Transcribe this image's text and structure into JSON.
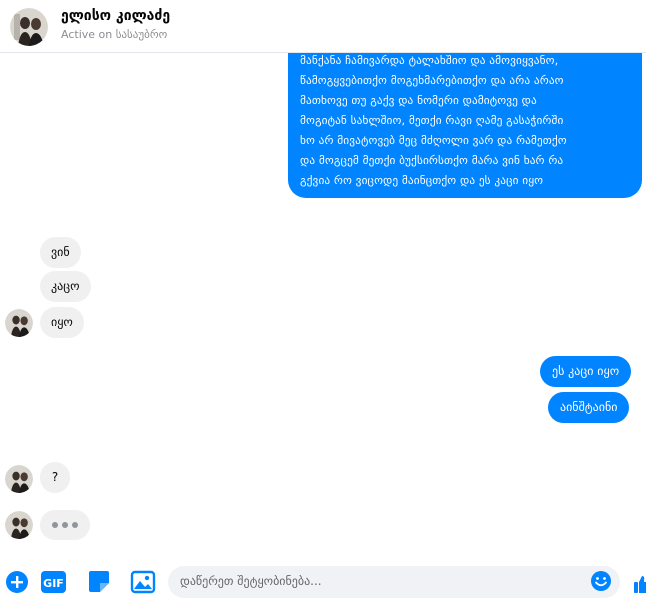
{
  "header": {
    "name": "ელისო კილაძე",
    "status": "Active on სასაუბრო"
  },
  "messages": {
    "big_lines": [
      "მანქანა ჩამივარდა ტალახშიო და ამოვიყვანო,",
      "წამოგყვებითქო მოგეხმარებითქო და არა არაო",
      "მათხოვე თუ გაქვ და ნომერი დამიტოვე და",
      "მოგიტან სახლშიო, მეთქი რავი ღამე გასაჭირში",
      "ხო არ მივატოვებ მეც მძღოლი ვარ და რამეთქო",
      "და მოგცემ მეთქი ბუქსირსთქო მარა ვინ ხარ რა",
      "გქვია რო ვიცოდე მაინცთქო და ეს კაცი იყო"
    ],
    "in1": "ვინ",
    "in2": "კაცო",
    "in3": "იყო",
    "out1": "ეს კაცი იყო",
    "out2": "აინშტაინი",
    "in4": "?"
  },
  "composer": {
    "placeholder": "დაწერეთ შეტყობინება..."
  },
  "icons": {
    "add": "plus-circle-icon",
    "gif": "gif-icon",
    "sticker": "sticker-icon",
    "image": "image-icon",
    "emoji": "emoji-icon",
    "like": "like-icon"
  },
  "colors": {
    "accent": "#0084ff",
    "incoming_bubble": "#f0f0f0"
  }
}
